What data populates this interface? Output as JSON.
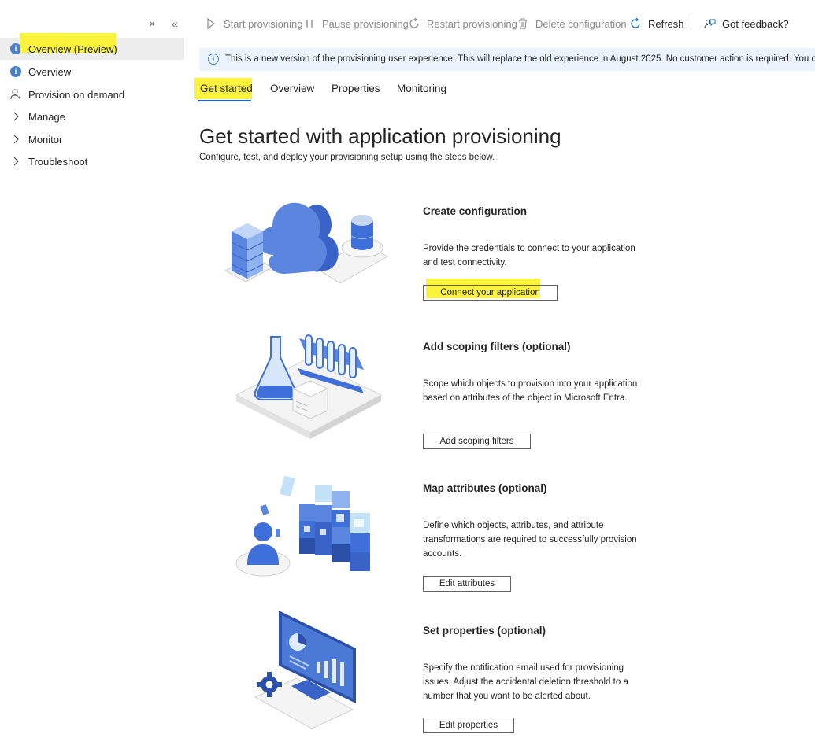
{
  "nav": {
    "close_glyph": "×",
    "collapse_glyph": "«",
    "items": [
      {
        "label": "Overview (Preview)",
        "icon": "info-icon"
      },
      {
        "label": "Overview",
        "icon": "info-icon"
      },
      {
        "label": "Provision on demand",
        "icon": "person-icon"
      },
      {
        "label": "Manage",
        "icon": "chevron-right-icon"
      },
      {
        "label": "Monitor",
        "icon": "chevron-right-icon"
      },
      {
        "label": "Troubleshoot",
        "icon": "chevron-right-icon"
      }
    ],
    "selected_index": 0
  },
  "toolbar": {
    "start": "Start provisioning",
    "pause": "Pause provisioning",
    "restart": "Restart provisioning",
    "delete": "Delete configuration",
    "refresh": "Refresh",
    "feedback": "Got feedback?"
  },
  "banner": {
    "text": "This is a new version of the provisioning user experience. This will replace the old experience in August 2025. No customer action is required. You can provide"
  },
  "tabs": {
    "items": [
      "Get started",
      "Overview",
      "Properties",
      "Monitoring"
    ],
    "active": "Get started"
  },
  "page": {
    "title": "Get started with application provisioning",
    "subtitle": "Configure, test, and deploy your provisioning setup using the steps below."
  },
  "steps": [
    {
      "title": "Create configuration",
      "description": "Provide the credentials to connect to your application and test connectivity.",
      "button": "Connect your application"
    },
    {
      "title": "Add scoping filters (optional)",
      "description": "Scope which objects to provision into your application based on attributes of the object in Microsoft Entra.",
      "button": "Add scoping filters"
    },
    {
      "title": "Map attributes (optional)",
      "description": "Define which objects, attributes, and attribute transformations are required to successfully provision accounts.",
      "button": "Edit attributes"
    },
    {
      "title": "Set properties (optional)",
      "description": "Specify the notification email used for provisioning issues. Adjust the accidental deletion threshold to a number that you want to be alerted about.",
      "button": "Edit properties"
    }
  ],
  "colors": {
    "highlight": "#fbf33b",
    "accent": "#0f6cbd",
    "banner_bg": "#ebf3fc",
    "illustration_blue": "#3f6fd8"
  }
}
